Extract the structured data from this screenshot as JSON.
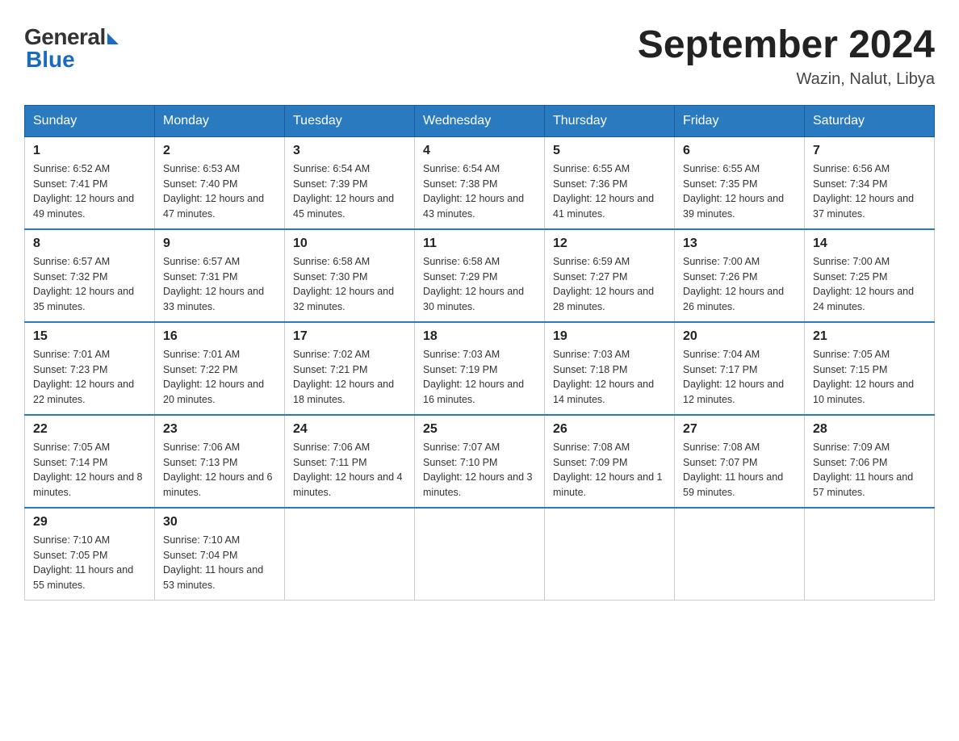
{
  "header": {
    "logo_general": "General",
    "logo_blue": "Blue",
    "month_year": "September 2024",
    "location": "Wazin, Nalut, Libya"
  },
  "days_of_week": [
    "Sunday",
    "Monday",
    "Tuesday",
    "Wednesday",
    "Thursday",
    "Friday",
    "Saturday"
  ],
  "weeks": [
    [
      {
        "day": "1",
        "sunrise": "6:52 AM",
        "sunset": "7:41 PM",
        "daylight": "12 hours and 49 minutes."
      },
      {
        "day": "2",
        "sunrise": "6:53 AM",
        "sunset": "7:40 PM",
        "daylight": "12 hours and 47 minutes."
      },
      {
        "day": "3",
        "sunrise": "6:54 AM",
        "sunset": "7:39 PM",
        "daylight": "12 hours and 45 minutes."
      },
      {
        "day": "4",
        "sunrise": "6:54 AM",
        "sunset": "7:38 PM",
        "daylight": "12 hours and 43 minutes."
      },
      {
        "day": "5",
        "sunrise": "6:55 AM",
        "sunset": "7:36 PM",
        "daylight": "12 hours and 41 minutes."
      },
      {
        "day": "6",
        "sunrise": "6:55 AM",
        "sunset": "7:35 PM",
        "daylight": "12 hours and 39 minutes."
      },
      {
        "day": "7",
        "sunrise": "6:56 AM",
        "sunset": "7:34 PM",
        "daylight": "12 hours and 37 minutes."
      }
    ],
    [
      {
        "day": "8",
        "sunrise": "6:57 AM",
        "sunset": "7:32 PM",
        "daylight": "12 hours and 35 minutes."
      },
      {
        "day": "9",
        "sunrise": "6:57 AM",
        "sunset": "7:31 PM",
        "daylight": "12 hours and 33 minutes."
      },
      {
        "day": "10",
        "sunrise": "6:58 AM",
        "sunset": "7:30 PM",
        "daylight": "12 hours and 32 minutes."
      },
      {
        "day": "11",
        "sunrise": "6:58 AM",
        "sunset": "7:29 PM",
        "daylight": "12 hours and 30 minutes."
      },
      {
        "day": "12",
        "sunrise": "6:59 AM",
        "sunset": "7:27 PM",
        "daylight": "12 hours and 28 minutes."
      },
      {
        "day": "13",
        "sunrise": "7:00 AM",
        "sunset": "7:26 PM",
        "daylight": "12 hours and 26 minutes."
      },
      {
        "day": "14",
        "sunrise": "7:00 AM",
        "sunset": "7:25 PM",
        "daylight": "12 hours and 24 minutes."
      }
    ],
    [
      {
        "day": "15",
        "sunrise": "7:01 AM",
        "sunset": "7:23 PM",
        "daylight": "12 hours and 22 minutes."
      },
      {
        "day": "16",
        "sunrise": "7:01 AM",
        "sunset": "7:22 PM",
        "daylight": "12 hours and 20 minutes."
      },
      {
        "day": "17",
        "sunrise": "7:02 AM",
        "sunset": "7:21 PM",
        "daylight": "12 hours and 18 minutes."
      },
      {
        "day": "18",
        "sunrise": "7:03 AM",
        "sunset": "7:19 PM",
        "daylight": "12 hours and 16 minutes."
      },
      {
        "day": "19",
        "sunrise": "7:03 AM",
        "sunset": "7:18 PM",
        "daylight": "12 hours and 14 minutes."
      },
      {
        "day": "20",
        "sunrise": "7:04 AM",
        "sunset": "7:17 PM",
        "daylight": "12 hours and 12 minutes."
      },
      {
        "day": "21",
        "sunrise": "7:05 AM",
        "sunset": "7:15 PM",
        "daylight": "12 hours and 10 minutes."
      }
    ],
    [
      {
        "day": "22",
        "sunrise": "7:05 AM",
        "sunset": "7:14 PM",
        "daylight": "12 hours and 8 minutes."
      },
      {
        "day": "23",
        "sunrise": "7:06 AM",
        "sunset": "7:13 PM",
        "daylight": "12 hours and 6 minutes."
      },
      {
        "day": "24",
        "sunrise": "7:06 AM",
        "sunset": "7:11 PM",
        "daylight": "12 hours and 4 minutes."
      },
      {
        "day": "25",
        "sunrise": "7:07 AM",
        "sunset": "7:10 PM",
        "daylight": "12 hours and 3 minutes."
      },
      {
        "day": "26",
        "sunrise": "7:08 AM",
        "sunset": "7:09 PM",
        "daylight": "12 hours and 1 minute."
      },
      {
        "day": "27",
        "sunrise": "7:08 AM",
        "sunset": "7:07 PM",
        "daylight": "11 hours and 59 minutes."
      },
      {
        "day": "28",
        "sunrise": "7:09 AM",
        "sunset": "7:06 PM",
        "daylight": "11 hours and 57 minutes."
      }
    ],
    [
      {
        "day": "29",
        "sunrise": "7:10 AM",
        "sunset": "7:05 PM",
        "daylight": "11 hours and 55 minutes."
      },
      {
        "day": "30",
        "sunrise": "7:10 AM",
        "sunset": "7:04 PM",
        "daylight": "11 hours and 53 minutes."
      },
      null,
      null,
      null,
      null,
      null
    ]
  ],
  "labels": {
    "sunrise": "Sunrise: ",
    "sunset": "Sunset: ",
    "daylight": "Daylight: "
  }
}
